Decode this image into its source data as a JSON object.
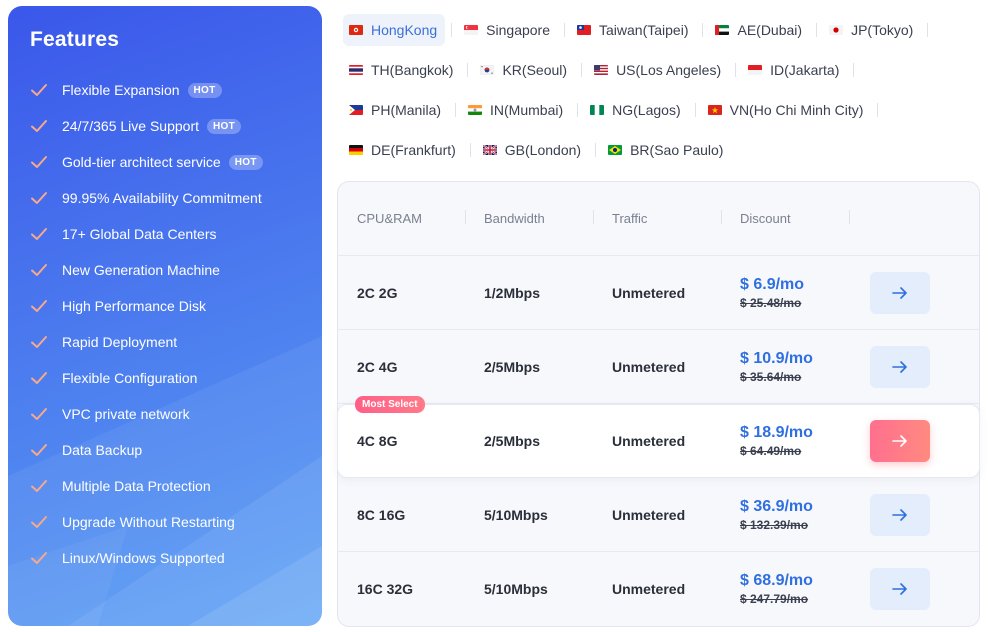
{
  "features": {
    "title": "Features",
    "hot_label": "HOT",
    "items": [
      {
        "label": "Flexible Expansion",
        "hot": true
      },
      {
        "label": "24/7/365 Live Support",
        "hot": true
      },
      {
        "label": "Gold-tier architect service",
        "hot": true
      },
      {
        "label": "99.95% Availability Commitment",
        "hot": false
      },
      {
        "label": "17+ Global Data Centers",
        "hot": false
      },
      {
        "label": "New Generation Machine",
        "hot": false
      },
      {
        "label": "High Performance Disk",
        "hot": false
      },
      {
        "label": "Rapid Deployment",
        "hot": false
      },
      {
        "label": "Flexible Configuration",
        "hot": false
      },
      {
        "label": "VPC private network",
        "hot": false
      },
      {
        "label": "Data Backup",
        "hot": false
      },
      {
        "label": "Multiple Data Protection",
        "hot": false
      },
      {
        "label": "Upgrade Without Restarting",
        "hot": false
      },
      {
        "label": "Linux/Windows Supported",
        "hot": false
      }
    ]
  },
  "regions": [
    {
      "label": "HongKong",
      "flag": "hk-flag-icon",
      "active": true
    },
    {
      "label": "Singapore",
      "flag": "sg-flag-icon"
    },
    {
      "label": "Taiwan(Taipei)",
      "flag": "tw-flag-icon"
    },
    {
      "label": "AE(Dubai)",
      "flag": "ae-flag-icon"
    },
    {
      "label": "JP(Tokyo)",
      "flag": "jp-flag-icon"
    },
    {
      "label": "TH(Bangkok)",
      "flag": "th-flag-icon"
    },
    {
      "label": "KR(Seoul)",
      "flag": "kr-flag-icon"
    },
    {
      "label": "US(Los Angeles)",
      "flag": "us-flag-icon"
    },
    {
      "label": "ID(Jakarta)",
      "flag": "id-flag-icon"
    },
    {
      "label": "PH(Manila)",
      "flag": "ph-flag-icon"
    },
    {
      "label": "IN(Mumbai)",
      "flag": "in-flag-icon"
    },
    {
      "label": "NG(Lagos)",
      "flag": "ng-flag-icon"
    },
    {
      "label": "VN(Ho Chi Minh City)",
      "flag": "vn-flag-icon"
    },
    {
      "label": "DE(Frankfurt)",
      "flag": "de-flag-icon"
    },
    {
      "label": "GB(London)",
      "flag": "gb-flag-icon"
    },
    {
      "label": "BR(Sao Paulo)",
      "flag": "br-flag-icon"
    }
  ],
  "table": {
    "headers": [
      "CPU&RAM",
      "Bandwidth",
      "Traffic",
      "Discount"
    ],
    "featured_badge": "Most Select",
    "plans": [
      {
        "cpu_ram": "2C 2G",
        "bandwidth": "1/2Mbps",
        "traffic": "Unmetered",
        "price": "$ 6.9/mo",
        "old_price": "$ 25.48/mo",
        "featured": false
      },
      {
        "cpu_ram": "2C 4G",
        "bandwidth": "2/5Mbps",
        "traffic": "Unmetered",
        "price": "$ 10.9/mo",
        "old_price": "$ 35.64/mo",
        "featured": false
      },
      {
        "cpu_ram": "4C 8G",
        "bandwidth": "2/5Mbps",
        "traffic": "Unmetered",
        "price": "$ 18.9/mo",
        "old_price": "$ 64.49/mo",
        "featured": true
      },
      {
        "cpu_ram": "8C 16G",
        "bandwidth": "5/10Mbps",
        "traffic": "Unmetered",
        "price": "$ 36.9/mo",
        "old_price": "$ 132.39/mo",
        "featured": false
      },
      {
        "cpu_ram": "16C 32G",
        "bandwidth": "5/10Mbps",
        "traffic": "Unmetered",
        "price": "$ 68.9/mo",
        "old_price": "$ 247.79/mo",
        "featured": false
      }
    ]
  },
  "colors": {
    "accent_blue": "#2f6fe0",
    "featured_pink": "#ff6f8e",
    "check_orange": "#f7a98a",
    "panel_blue": "#4a78ee"
  }
}
